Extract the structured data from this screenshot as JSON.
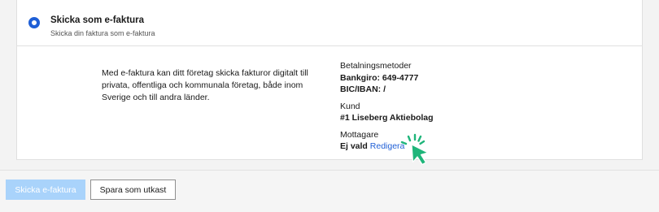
{
  "option": {
    "title": "Skicka som e-faktura",
    "subtitle": "Skicka din faktura som e-faktura",
    "selected": true
  },
  "description": "Med e-faktura kan ditt företag skicka fakturor digitalt till privata, offentliga och kommunala företag, både inom Sverige och till andra länder.",
  "payment": {
    "label": "Betalningsmetoder",
    "bankgiro": "Bankgiro: 649-4777",
    "bic_iban": "BIC/IBAN: /"
  },
  "customer": {
    "label": "Kund",
    "value": "#1 Liseberg Aktiebolag"
  },
  "recipient": {
    "label": "Mottagare",
    "value": "Ej vald",
    "edit_link": "Redigera"
  },
  "buttons": {
    "send": "Skicka e-faktura",
    "save_draft": "Spara som utkast"
  },
  "colors": {
    "accent": "#1f5fd6",
    "primary_disabled": "#a9d3fb",
    "cursor": "#1fb57a"
  },
  "icons": {
    "cursor": "pointer-cursor-icon"
  }
}
